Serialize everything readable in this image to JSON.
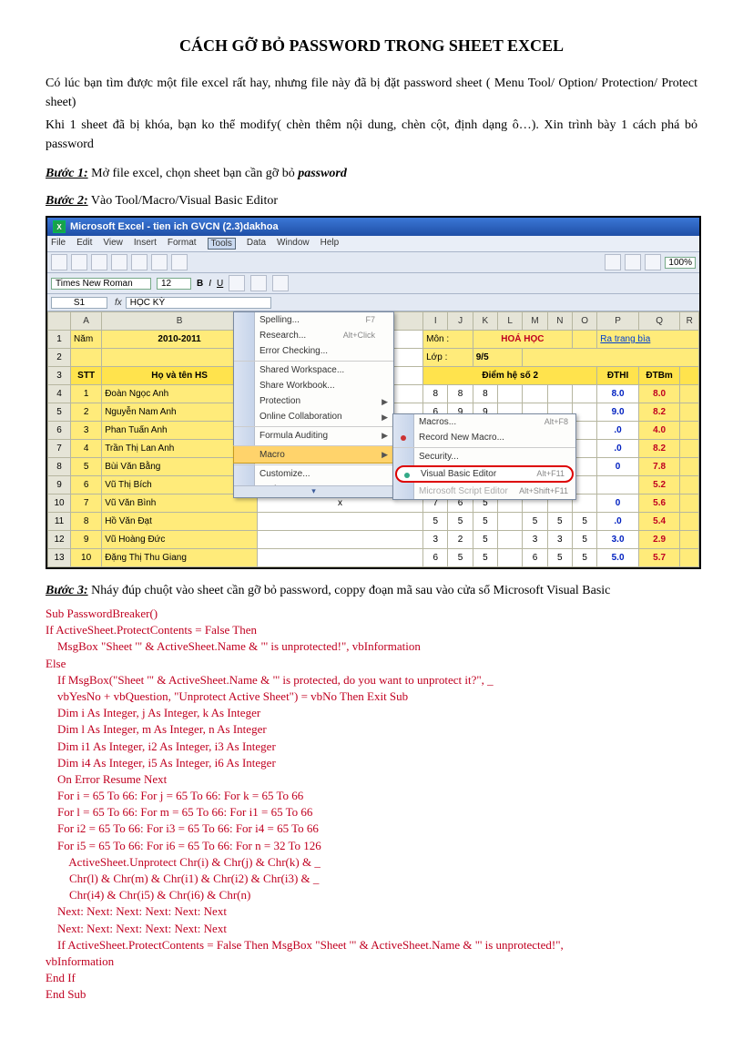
{
  "title": "CÁCH GỠ BỎ PASSWORD TRONG SHEET EXCEL",
  "intro1": "Có lúc bạn tìm được một file excel rất hay, nhưng file này đã bị đặt password sheet ( Menu Tool/ Option/ Protection/ Protect sheet)",
  "intro2": "Khi 1 sheet đã bị khóa, bạn ko thể modify( chèn thêm nội dung, chèn cột, định dạng ô…). Xin trình bày 1 cách phá bỏ password",
  "step1_label": "Bước 1:",
  "step1_text": " Mở file excel, chọn sheet bạn cần gỡ bỏ ",
  "step1_bold": "password",
  "step2_label": "Bước 2:",
  "step2_text": " Vào Tool/Macro/Visual  Basic Editor",
  "step3_label": "Bước 3:",
  "step3_text": " Nháy đúp chuột vào sheet cần gỡ bỏ password, coppy đoạn mã sau vào cửa sổ Microsoft Visual Basic",
  "excel": {
    "titlebar": "Microsoft Excel - tien ich GVCN (2.3)dakhoa",
    "menus": [
      "File",
      "Edit",
      "View",
      "Insert",
      "Format",
      "Tools",
      "Data",
      "Window",
      "Help"
    ],
    "zoom": "100%",
    "font": "Times New Roman",
    "fontsize": "12",
    "cellref": "S1",
    "fxlabel": "fx",
    "fxval": "HỌC KỲ",
    "colheads": [
      "",
      "A",
      "B",
      "",
      "I",
      "J",
      "K",
      "L",
      "M",
      "N",
      "O",
      "P",
      "Q",
      "R"
    ],
    "row1": {
      "nam": "Năm",
      "year": "2010-2011",
      "mon": "Môn :",
      "monval": "HOÁ HỌC",
      "link": "Ra trang bìa"
    },
    "row2": {
      "lop": "Lớp :",
      "lopval": "9/5"
    },
    "row3": {
      "stt": "STT",
      "name": "Họ và tên HS",
      "diem": "Điểm hệ số 2",
      "d1": "ĐTHI",
      "d2": "ĐTBm"
    },
    "rows": [
      {
        "n": "4",
        "stt": "1",
        "name": "Đoàn Ngọc Anh",
        "c": [
          "8",
          "8",
          "8",
          "",
          "",
          "",
          ""
        ],
        "b": "8.0",
        "r": "8.0"
      },
      {
        "n": "5",
        "stt": "2",
        "name": "Nguyễn Nam Anh",
        "c": [
          "6",
          "9",
          "9",
          "",
          "",
          "",
          ""
        ],
        "b": "9.0",
        "r": "8.2"
      },
      {
        "n": "6",
        "stt": "3",
        "name": "Phan Tuấn Anh",
        "c": [
          "",
          "",
          "",
          "",
          "",
          "",
          ""
        ],
        "b": ".0",
        "r": "4.0"
      },
      {
        "n": "7",
        "stt": "4",
        "name": "Trần Thị Lan Anh",
        "c": [
          "",
          "",
          "",
          "",
          "",
          "",
          ""
        ],
        "b": ".0",
        "r": "8.2"
      },
      {
        "n": "8",
        "stt": "5",
        "name": "Bùi Văn Bằng",
        "c": [
          "",
          "",
          "",
          "",
          "",
          "",
          ""
        ],
        "b": "0",
        "r": "7.8"
      },
      {
        "n": "9",
        "stt": "6",
        "name": "Vũ Thị Bích",
        "c": [
          "",
          "",
          "",
          "",
          "",
          "",
          ""
        ],
        "b": "",
        "r": "5.2"
      },
      {
        "n": "10",
        "stt": "7",
        "name": "Vũ Văn Bình",
        "x": "x",
        "c": [
          "7",
          "6",
          "5",
          "",
          "",
          "",
          ""
        ],
        "b": "0",
        "r": "5.6"
      },
      {
        "n": "11",
        "stt": "8",
        "name": "Hồ Văn Đạt",
        "c": [
          "5",
          "5",
          "5",
          "",
          "5",
          "5",
          "5"
        ],
        "b": ".0",
        "r": "5.4"
      },
      {
        "n": "12",
        "stt": "9",
        "name": "Vũ Hoàng Đức",
        "c": [
          "3",
          "2",
          "5",
          "",
          "3",
          "3",
          "5"
        ],
        "b": "3.0",
        "r": "2.9"
      },
      {
        "n": "13",
        "stt": "10",
        "name": "Đặng Thị Thu Giang",
        "c": [
          "6",
          "5",
          "5",
          "",
          "6",
          "5",
          "5"
        ],
        "b": "5.0",
        "r": "5.7"
      }
    ],
    "tools_menu": [
      {
        "t": "Spelling...",
        "s": "F7"
      },
      {
        "t": "Research...",
        "s": "Alt+Click"
      },
      {
        "t": "Error Checking..."
      },
      {
        "t": "Shared Workspace...",
        "sep": true
      },
      {
        "t": "Share Workbook..."
      },
      {
        "t": "Protection",
        "arr": true
      },
      {
        "t": "Online Collaboration",
        "arr": true
      },
      {
        "t": "Formula Auditing",
        "arr": true,
        "sep": true
      },
      {
        "t": "Macro",
        "arr": true,
        "hi": true,
        "sep": true
      },
      {
        "t": "Customize...",
        "sep": true
      },
      {
        "t": "Options..."
      }
    ],
    "macro_sub": [
      {
        "t": "Macros...",
        "s": "Alt+F8"
      },
      {
        "t": "Record New Macro...",
        "dot": "r"
      },
      {
        "t": "Security...",
        "sep": true
      },
      {
        "t": "Visual Basic Editor",
        "s": "Alt+F11",
        "hl": true,
        "sep": true,
        "dot": "g"
      },
      {
        "t": "Microsoft Script Editor",
        "s": "Alt+Shift+F11",
        "dis": true
      }
    ]
  },
  "code": "Sub PasswordBreaker()\nIf ActiveSheet.ProtectContents = False Then\n    MsgBox \"Sheet '\" & ActiveSheet.Name & \"' is unprotected!\", vbInformation\nElse\n    If MsgBox(\"Sheet '\" & ActiveSheet.Name & \"' is protected, do you want to unprotect it?\", _\n    vbYesNo + vbQuestion, \"Unprotect Active Sheet\") = vbNo Then Exit Sub\n    Dim i As Integer, j As Integer, k As Integer\n    Dim l As Integer, m As Integer, n As Integer\n    Dim i1 As Integer, i2 As Integer, i3 As Integer\n    Dim i4 As Integer, i5 As Integer, i6 As Integer\n    On Error Resume Next\n    For i = 65 To 66: For j = 65 To 66: For k = 65 To 66\n    For l = 65 To 66: For m = 65 To 66: For i1 = 65 To 66\n    For i2 = 65 To 66: For i3 = 65 To 66: For i4 = 65 To 66\n    For i5 = 65 To 66: For i6 = 65 To 66: For n = 32 To 126\n        ActiveSheet.Unprotect Chr(i) & Chr(j) & Chr(k) & _\n        Chr(l) & Chr(m) & Chr(i1) & Chr(i2) & Chr(i3) & _\n        Chr(i4) & Chr(i5) & Chr(i6) & Chr(n)\n    Next: Next: Next: Next: Next: Next\n    Next: Next: Next: Next: Next: Next\n    If ActiveSheet.ProtectContents = False Then MsgBox \"Sheet '\" & ActiveSheet.Name & \"' is unprotected!\",\nvbInformation\nEnd If\nEnd Sub"
}
